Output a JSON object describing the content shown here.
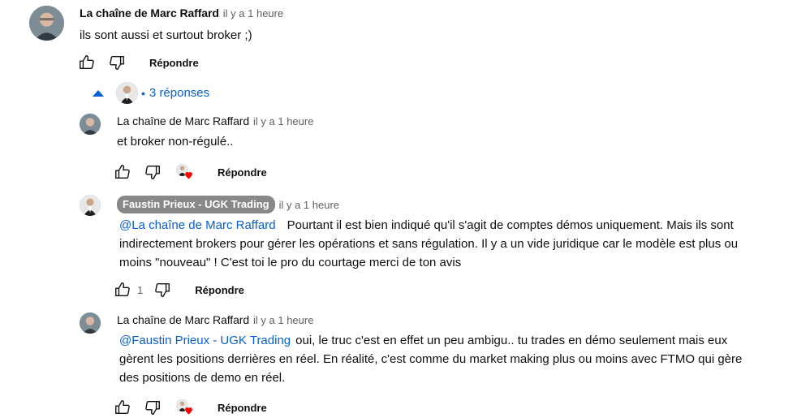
{
  "comment": {
    "author": "La chaîne de Marc Raffard",
    "time": "il y a 1 heure",
    "text": "ils sont aussi et surtout broker ;)",
    "reply_label": "Répondre"
  },
  "replies_toggle": {
    "label": "3 réponses",
    "dot": "•"
  },
  "replies": [
    {
      "author": "La chaîne de Marc Raffard",
      "time": "il y a 1 heure",
      "text": "et broker non-régulé..",
      "reply_label": "Répondre"
    },
    {
      "author": "Faustin Prieux - UGK Trading",
      "time": "il y a 1 heure",
      "mention": "@La chaîne de Marc Raffard",
      "text_line1": "Pourtant il est bien indiqué qu'il s'agit de comptes démos uniquement. Mais ils sont",
      "text_line2": "indirectement brokers pour gérer les opérations et sans régulation. Il y a un vide juridique car le modèle est plus ou",
      "text_line3": "moins \"nouveau\" ! C'est toi le pro du courtage merci de ton avis",
      "like_count": "1",
      "reply_label": "Répondre"
    },
    {
      "author": "La chaîne de Marc Raffard",
      "time": "il y a 1 heure",
      "mention": "@Faustin Prieux - UGK Trading",
      "text_line1": "oui, le truc c'est en effet un peu ambigu.. tu trades en démo seulement mais eux",
      "text_line2": "gèrent les positions derrières en réel. En réalité, c'est comme du market making plus ou moins avec FTMO qui gère",
      "text_line3": "des positions de demo en réel.",
      "reply_label": "Répondre"
    }
  ],
  "colors": {
    "link": "#065fd4",
    "muted": "#606060",
    "chip": "#888888",
    "heart": "#ff0000"
  },
  "icons": [
    "thumbs-up-icon",
    "thumbs-down-icon",
    "creator-heart-icon",
    "caret-up-icon"
  ]
}
